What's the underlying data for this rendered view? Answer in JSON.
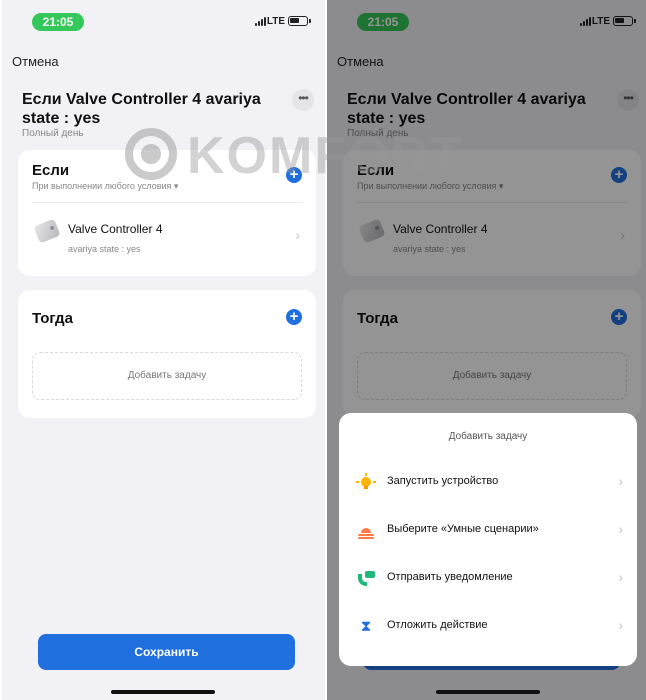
{
  "status_bar": {
    "time": "21:05",
    "network": "LTE"
  },
  "header": {
    "cancel_label": "Отмена",
    "title": "Если Valve Controller 4 avariya state : yes",
    "subtitle": "Полный день",
    "more_label": "•••"
  },
  "if_card": {
    "heading": "Если",
    "condition_hint": "При выполнении любого условия ▾",
    "add_label": "+",
    "condition": {
      "device": "Valve Controller 4",
      "state": "avariya state : yes"
    }
  },
  "then_card": {
    "heading": "Тогда",
    "add_label": "+",
    "add_task_label": "Добавить задачу"
  },
  "save_label": "Сохранить",
  "watermark": {
    "text": "KOMFORT"
  },
  "chevron": "›",
  "add_task_sheet": {
    "title": "Добавить задачу",
    "items": [
      {
        "label": "Запустить устройство",
        "icon": "bulb-icon"
      },
      {
        "label": "Выберите «Умные сценарии»",
        "icon": "sunrise-icon"
      },
      {
        "label": "Отправить уведомление",
        "icon": "notification-icon"
      },
      {
        "label": "Отложить действие",
        "icon": "hourglass-icon",
        "glyph": "⧗"
      }
    ]
  },
  "colors": {
    "accent": "#1f6fde",
    "time_pill": "#34c759",
    "background": "#f2f2f6"
  }
}
